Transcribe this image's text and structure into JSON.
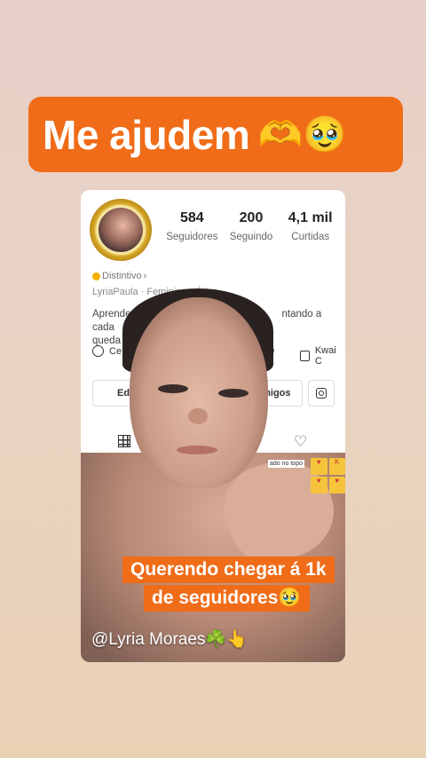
{
  "banner": {
    "text": "Me ajudem",
    "emoji": "🫶🥹"
  },
  "profile": {
    "stats": [
      {
        "value": "584",
        "label": "Seguidores"
      },
      {
        "value": "200",
        "label": "Seguindo"
      },
      {
        "value": "4,1 mil",
        "label": "Curtidas"
      }
    ],
    "badge": "Distintivo",
    "meta": "LyriaPaula · Feminino · Áries",
    "bio_line1": "Aprende",
    "bio_line1_end": "ntando a cada",
    "bio_line2": "queda 😂",
    "links": {
      "left": "Ce",
      "mid": "op",
      "right": "Kwai C"
    },
    "edit_label": "Ed",
    "friends_label": "amigos"
  },
  "overlay": {
    "top_tag": "ado no topo",
    "caption_line1": "Querendo chegar á 1k",
    "caption_line2": "de seguidores🥹",
    "handle": "@Lyria Moraes☘️👆"
  }
}
